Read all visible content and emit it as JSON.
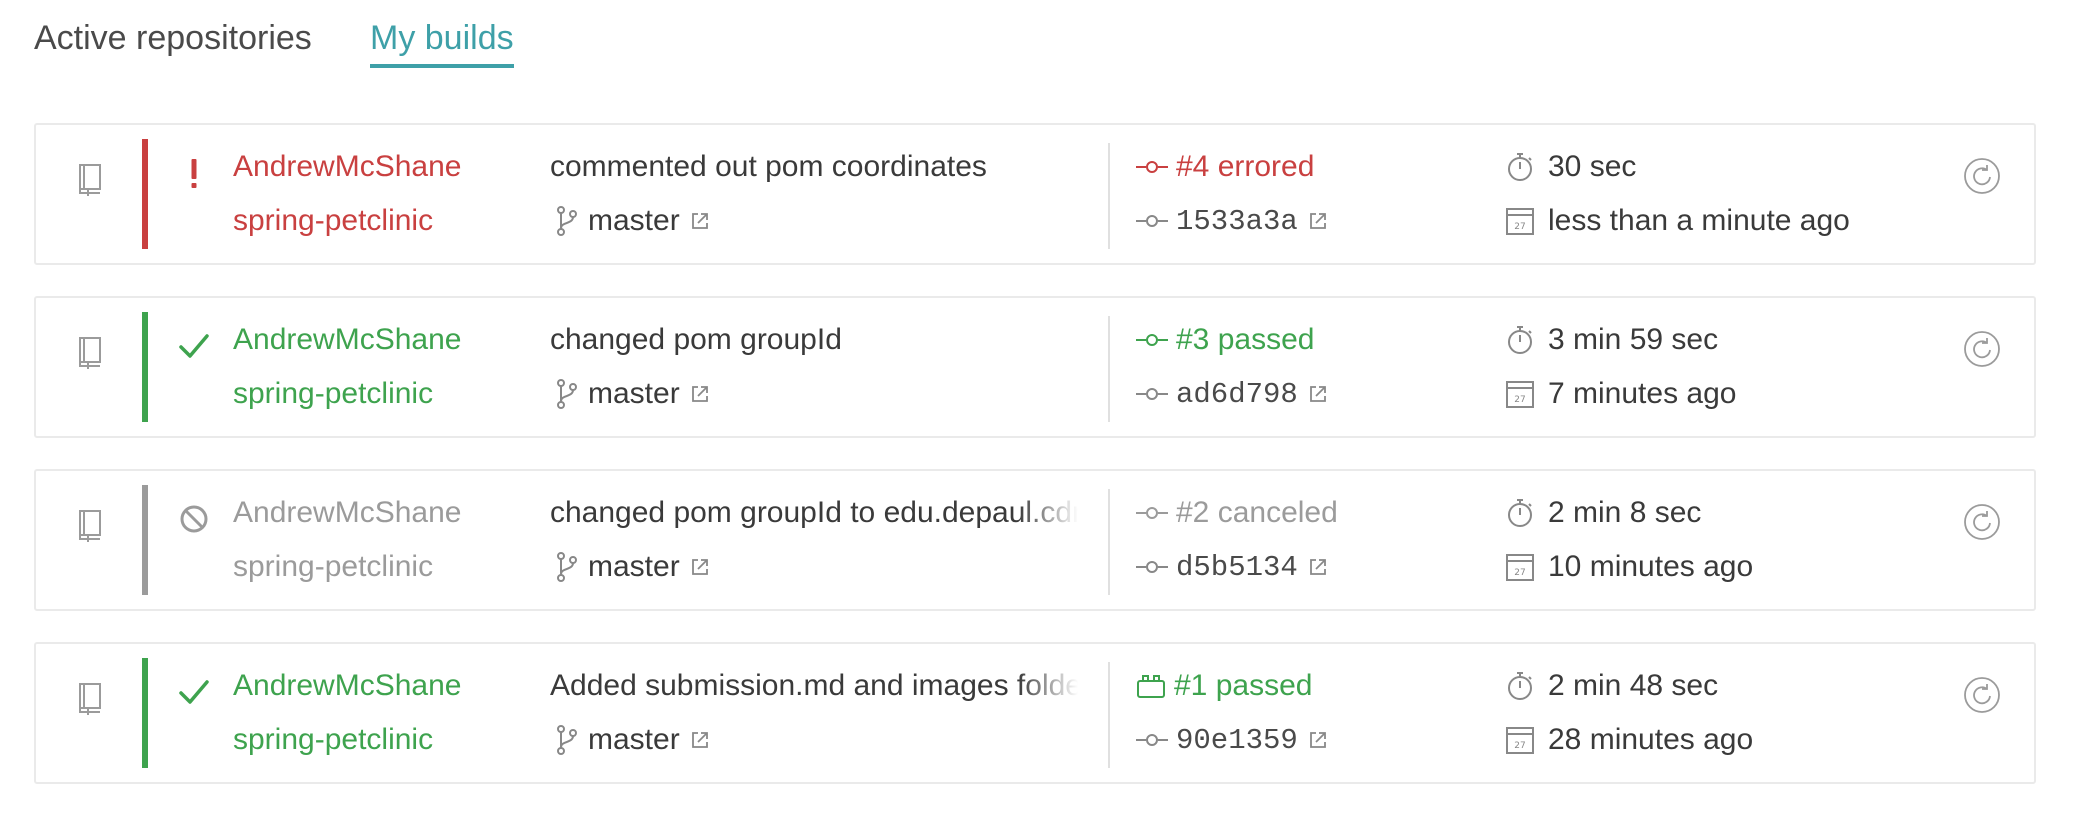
{
  "tabs": {
    "active_repositories": "Active repositories",
    "my_builds": "My builds"
  },
  "colors": {
    "errored": "#c94040",
    "passed": "#3ea34e",
    "canceled": "#9b9b9b",
    "accent": "#3ea0a8"
  },
  "builds": [
    {
      "status": "errored",
      "status_icon": "exclamation-icon",
      "owner": "AndrewMcShane",
      "repo": "spring-petclinic",
      "message": "commented out pom coordinates",
      "branch": "master",
      "build_label": "#4 errored",
      "build_icon": "commit-icon",
      "sha": "1533a3a",
      "duration": "30 sec",
      "finished": "less than a minute ago"
    },
    {
      "status": "passed",
      "status_icon": "check-icon",
      "owner": "AndrewMcShane",
      "repo": "spring-petclinic",
      "message": "changed pom groupId",
      "branch": "master",
      "build_label": "#3 passed",
      "build_icon": "commit-icon",
      "sha": "ad6d798",
      "duration": "3 min 59 sec",
      "finished": "7 minutes ago"
    },
    {
      "status": "canceled",
      "status_icon": "cancel-icon",
      "owner": "AndrewMcShane",
      "repo": "spring-petclinic",
      "message": "changed pom groupId to edu.depaul.cdm",
      "branch": "master",
      "build_label": "#2 canceled",
      "build_icon": "commit-icon",
      "sha": "d5b5134",
      "duration": "2 min 8 sec",
      "finished": "10 minutes ago"
    },
    {
      "status": "passed",
      "status_icon": "check-icon",
      "owner": "AndrewMcShane",
      "repo": "spring-petclinic",
      "message": "Added submission.md and images folder",
      "branch": "master",
      "build_label": "#1 passed",
      "build_icon": "push-icon",
      "sha": "90e1359",
      "duration": "2 min 48 sec",
      "finished": "28 minutes ago"
    }
  ]
}
